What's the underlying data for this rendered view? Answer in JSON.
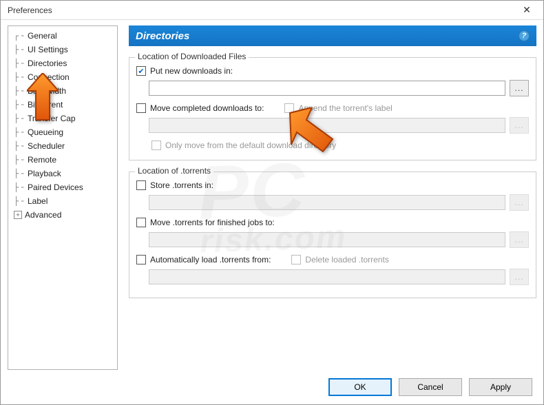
{
  "window": {
    "title": "Preferences"
  },
  "sidebar": {
    "items": [
      "General",
      "UI Settings",
      "Directories",
      "Connection",
      "Bandwidth",
      "BitTorrent",
      "Transfer Cap",
      "Queueing",
      "Scheduler",
      "Remote",
      "Playback",
      "Paired Devices",
      "Label",
      "Advanced"
    ],
    "selected": "Directories"
  },
  "header": {
    "title": "Directories",
    "help_tooltip": "?"
  },
  "group1": {
    "title": "Location of Downloaded Files",
    "put_new_label": "Put new downloads in:",
    "put_new_checked": true,
    "put_new_path": "",
    "move_completed_label": "Move completed downloads to:",
    "move_completed_checked": false,
    "move_completed_path": "",
    "append_label_label": "Append the torrent's label",
    "only_move_default_label": "Only move from the default download directory"
  },
  "group2": {
    "title": "Location of .torrents",
    "store_label": "Store .torrents in:",
    "store_path": "",
    "move_finished_label": "Move .torrents for finished jobs to:",
    "move_finished_path": "",
    "autoload_label": "Automatically load .torrents from:",
    "autoload_path": "",
    "delete_loaded_label": "Delete loaded .torrents"
  },
  "buttons": {
    "ok": "OK",
    "cancel": "Cancel",
    "apply": "Apply"
  },
  "browse_label": "...",
  "watermark": {
    "line1": "PC",
    "line2": "risk.com"
  }
}
